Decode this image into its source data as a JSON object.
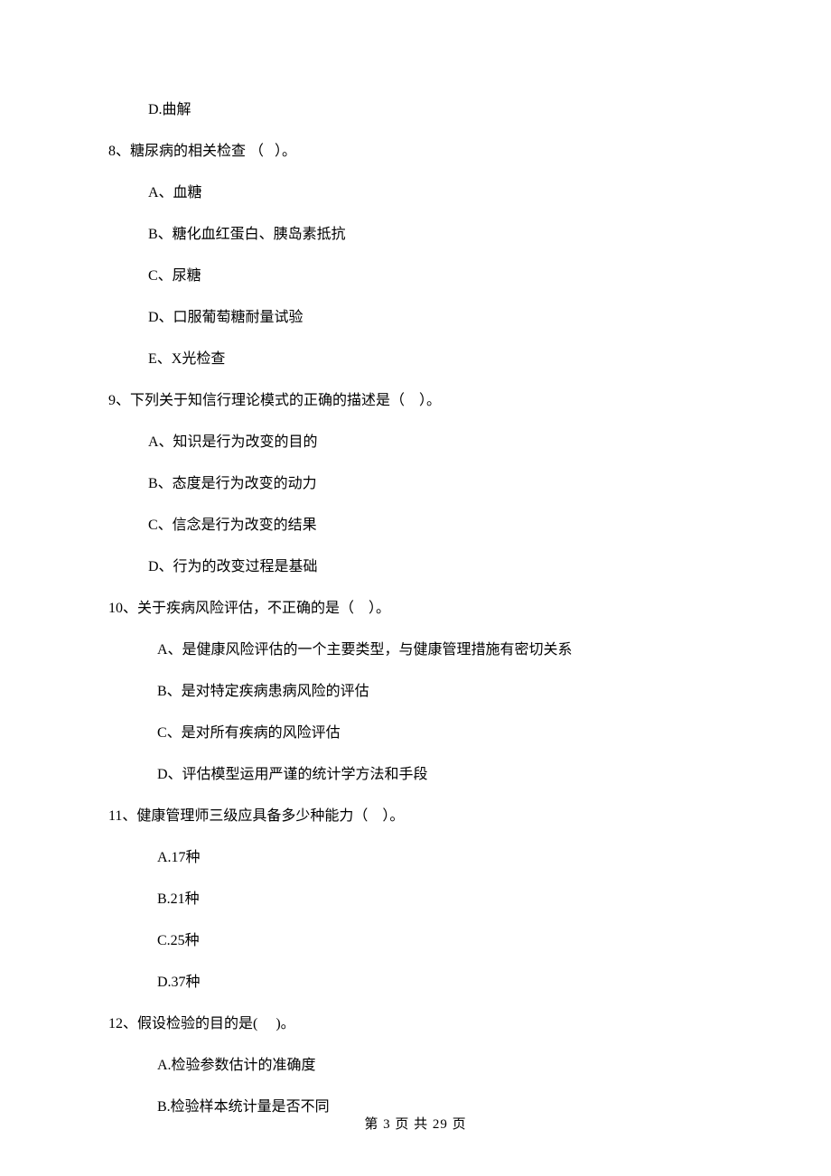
{
  "orphan_option": "D.曲解",
  "questions": [
    {
      "number": "8、",
      "stem": "糖尿病的相关检查 （   ）。",
      "options": [
        "A、血糖",
        "B、糖化血红蛋白、胰岛素抵抗",
        "C、尿糖",
        "D、口服葡萄糖耐量试验",
        "E、X光检查"
      ],
      "indent_options": false
    },
    {
      "number": "9、",
      "stem": "下列关于知信行理论模式的正确的描述是（    ）。",
      "options": [
        "A、知识是行为改变的目的",
        "B、态度是行为改变的动力",
        "C、信念是行为改变的结果",
        "D、行为的改变过程是基础"
      ],
      "indent_options": false
    },
    {
      "number": "10、",
      "stem": "关于疾病风险评估，不正确的是（    ）。",
      "options": [
        "A、是健康风险评估的一个主要类型，与健康管理措施有密切关系",
        "B、是对特定疾病患病风险的评估",
        "C、是对所有疾病的风险评估",
        "D、评估模型运用严谨的统计学方法和手段"
      ],
      "indent_options": true
    },
    {
      "number": "11、",
      "stem": "健康管理师三级应具备多少种能力（    ）。",
      "options": [
        "A.17种",
        "B.21种",
        "C.25种",
        "D.37种"
      ],
      "indent_options": true
    },
    {
      "number": "12、",
      "stem": "假设检验的目的是(     )。",
      "options": [
        "A.检验参数估计的准确度",
        "B.检验样本统计量是否不同"
      ],
      "indent_options": true
    }
  ],
  "footer": "第 3 页 共 29 页"
}
